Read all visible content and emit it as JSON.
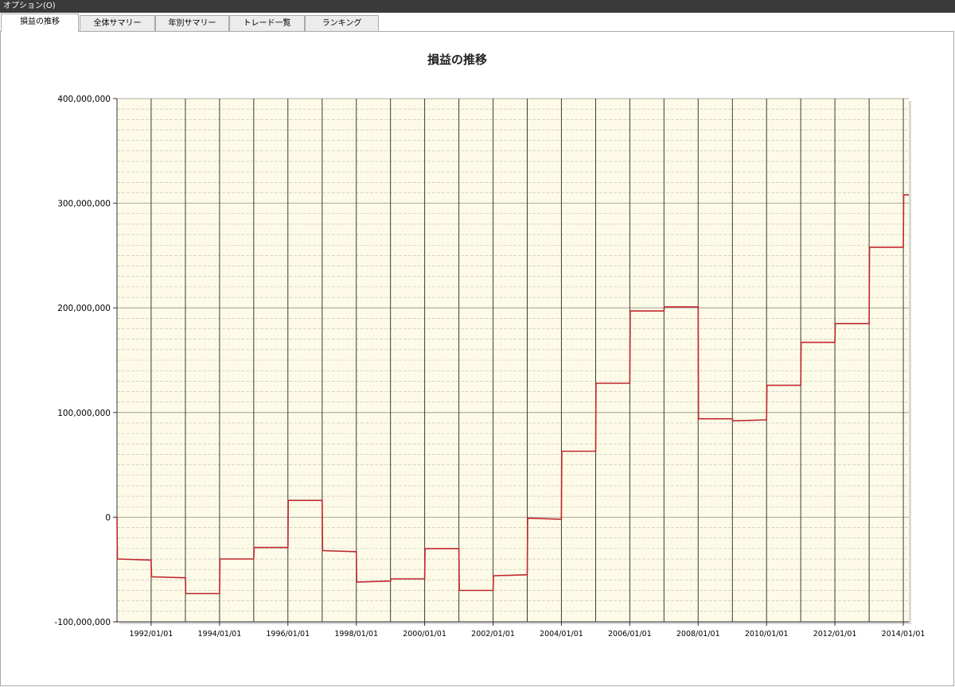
{
  "menubar": {
    "options_label": "オプション(O)"
  },
  "tabs": [
    {
      "label": "損益の推移"
    },
    {
      "label": "全体サマリー"
    },
    {
      "label": "年別サマリー"
    },
    {
      "label": "トレード一覧"
    },
    {
      "label": "ランキング"
    }
  ],
  "active_tab": 0,
  "colors": {
    "plot_bg": "#fdfbe8",
    "line": "#c0282d",
    "grid_major": "#3a3a3a",
    "grid_minor": "#bdbdb5"
  },
  "chart_data": {
    "type": "line",
    "title": "損益の推移",
    "xlabel": "",
    "ylabel": "",
    "xlim": [
      "1991/01/01",
      "2014/03/01"
    ],
    "ylim": [
      -100000000,
      400000000
    ],
    "ytick_values": [
      -100000000,
      0,
      100000000,
      200000000,
      300000000,
      400000000
    ],
    "ytick_labels": [
      "-100,000,000",
      "0",
      "100,000,000",
      "200,000,000",
      "300,000,000",
      "400,000,000"
    ],
    "xtick_values": [
      "1992/01/01",
      "1994/01/01",
      "1996/01/01",
      "1998/01/01",
      "2000/01/01",
      "2002/01/01",
      "2004/01/01",
      "2006/01/01",
      "2008/01/01",
      "2010/01/01",
      "2012/01/01",
      "2014/01/01"
    ],
    "vertical_grid_dates": [
      "1992/01/01",
      "1993/01/01",
      "1994/01/01",
      "1995/01/01",
      "1996/01/01",
      "1997/01/01",
      "1998/01/01",
      "1999/01/01",
      "2000/01/01",
      "2001/01/01",
      "2002/01/01",
      "2003/01/01",
      "2004/01/01",
      "2005/01/01",
      "2006/01/01",
      "2007/01/01",
      "2008/01/01",
      "2009/01/01",
      "2010/01/01",
      "2011/01/01",
      "2012/01/01",
      "2013/01/01",
      "2014/01/01"
    ],
    "grid": true,
    "series": [
      {
        "points": [
          [
            "1991/01/01",
            0
          ],
          [
            "1991/01/05",
            -40000000
          ],
          [
            "1992/01/01",
            -41000000
          ],
          [
            "1992/01/05",
            -57000000
          ],
          [
            "1993/01/01",
            -58000000
          ],
          [
            "1993/01/05",
            -73000000
          ],
          [
            "1994/01/01",
            -73000000
          ],
          [
            "1994/01/05",
            -40000000
          ],
          [
            "1995/01/01",
            -40000000
          ],
          [
            "1995/01/05",
            -29000000
          ],
          [
            "1996/01/01",
            -29000000
          ],
          [
            "1996/01/05",
            16000000
          ],
          [
            "1997/01/01",
            16000000
          ],
          [
            "1997/01/05",
            -32000000
          ],
          [
            "1998/01/01",
            -33000000
          ],
          [
            "1998/01/05",
            -62000000
          ],
          [
            "1999/01/01",
            -61000000
          ],
          [
            "1999/01/05",
            -59000000
          ],
          [
            "2000/01/01",
            -59000000
          ],
          [
            "2000/01/05",
            -30000000
          ],
          [
            "2001/01/01",
            -30000000
          ],
          [
            "2001/01/05",
            -70000000
          ],
          [
            "2002/01/01",
            -70000000
          ],
          [
            "2002/01/05",
            -56000000
          ],
          [
            "2003/01/01",
            -55000000
          ],
          [
            "2003/01/05",
            -1000000
          ],
          [
            "2004/01/01",
            -2000000
          ],
          [
            "2004/01/05",
            63000000
          ],
          [
            "2005/01/01",
            63000000
          ],
          [
            "2005/01/05",
            128000000
          ],
          [
            "2006/01/01",
            128000000
          ],
          [
            "2006/01/05",
            197000000
          ],
          [
            "2007/01/01",
            197000000
          ],
          [
            "2007/01/05",
            201000000
          ],
          [
            "2008/01/01",
            201000000
          ],
          [
            "2008/01/05",
            94000000
          ],
          [
            "2009/01/01",
            94000000
          ],
          [
            "2009/01/05",
            92000000
          ],
          [
            "2010/01/01",
            93000000
          ],
          [
            "2010/01/05",
            126000000
          ],
          [
            "2011/01/01",
            126000000
          ],
          [
            "2011/01/05",
            167000000
          ],
          [
            "2012/01/01",
            167000000
          ],
          [
            "2012/01/05",
            185000000
          ],
          [
            "2013/01/01",
            185000000
          ],
          [
            "2013/01/05",
            258000000
          ],
          [
            "2014/01/01",
            258000000
          ],
          [
            "2014/01/05",
            308000000
          ],
          [
            "2014/03/01",
            308000000
          ]
        ]
      }
    ]
  }
}
